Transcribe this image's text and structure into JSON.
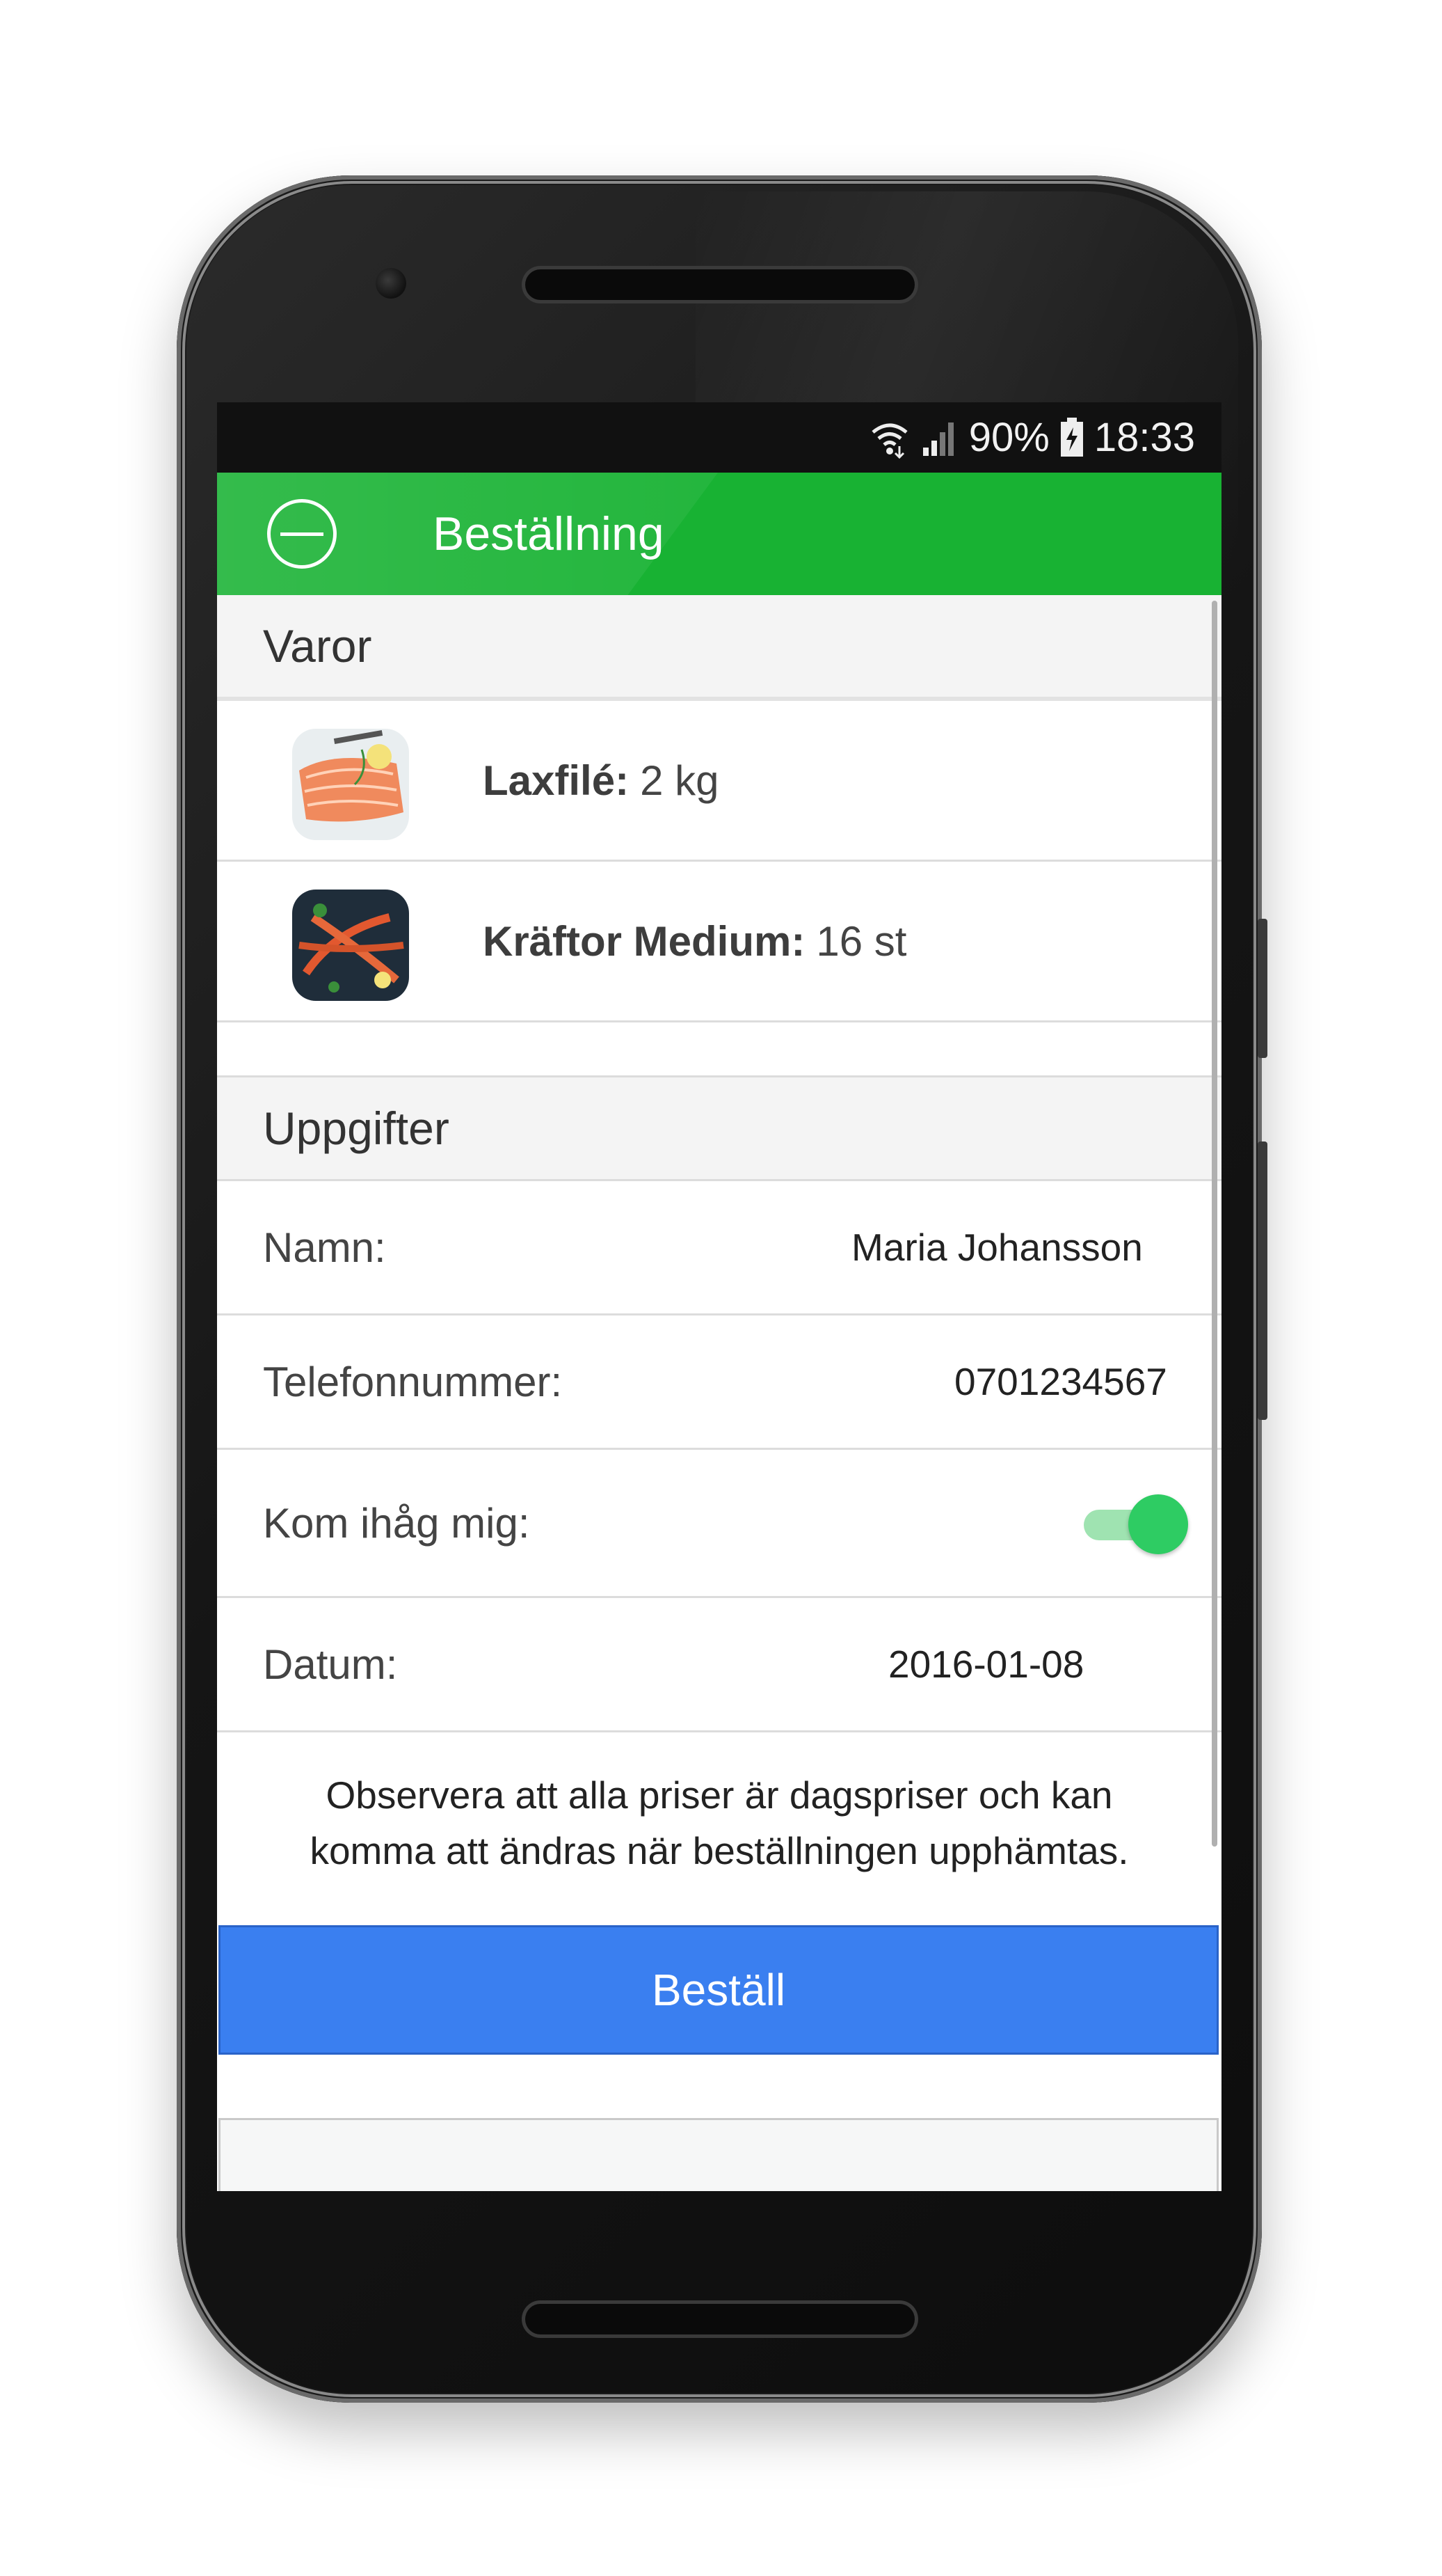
{
  "status_bar": {
    "battery": "90%",
    "time": "18:33",
    "icons": [
      "wifi-icon",
      "signal-icon",
      "battery-charging-icon"
    ]
  },
  "app_bar": {
    "title": "Beställning",
    "back_icon": "minus-circle-icon"
  },
  "items_section": {
    "header": "Varor",
    "items": [
      {
        "name": "Laxfilé:",
        "quantity": "2 kg",
        "image": "salmon-fillet-image"
      },
      {
        "name": "Kräftor Medium:",
        "quantity": "16 st",
        "image": "crayfish-image"
      }
    ]
  },
  "details_section": {
    "header": "Uppgifter",
    "name_label": "Namn:",
    "name_value": "Maria Johansson",
    "phone_label": "Telefonnummer:",
    "phone_value": "0701234567",
    "remember_label": "Kom ihåg mig:",
    "remember_on": true,
    "date_label": "Datum:",
    "date_value": "2016-01-08"
  },
  "notice": {
    "line1": "Observera att alla priser är dagspriser och kan",
    "line2": "komma att ändras när beställningen upphämtas."
  },
  "order_button": {
    "label": "Beställ",
    "color": "#3a7ff0"
  },
  "colors": {
    "app_bar": "#18b233",
    "toggle_on": "#2ecc63"
  }
}
